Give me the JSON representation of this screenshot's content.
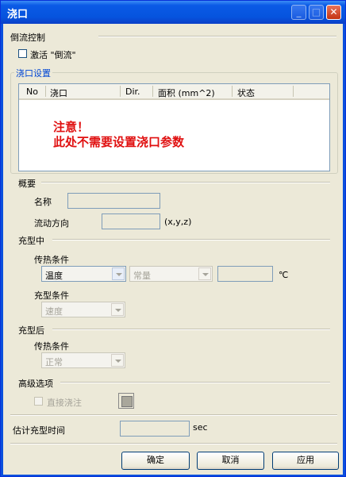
{
  "window": {
    "title": "浇口",
    "min_icon": "minimize-icon",
    "max_icon": "maximize-icon",
    "close_icon": "close-icon"
  },
  "backflow": {
    "header": "倒流控制",
    "checkbox_label": "激活 \"倒流\"",
    "checked": false
  },
  "gate_settings": {
    "header": "浇口设置",
    "columns": [
      "No",
      "浇口",
      "Dir.",
      "面积 (mm^2)",
      "状态"
    ],
    "rows": [],
    "notice_line1": "注意！",
    "notice_line2": "此处不需要设置浇口参数"
  },
  "summary": {
    "header": "概要",
    "name_label": "名称",
    "name_value": "",
    "flow_dir_label": "流动方向",
    "flow_dir_value": "",
    "flow_dir_unit": "(x,y,z)"
  },
  "filling": {
    "header": "充型中",
    "heat_label": "传热条件",
    "heat_type": "温度",
    "heat_mode": "常量",
    "heat_value": "",
    "heat_unit": "℃",
    "fill_cond_label": "充型条件",
    "fill_cond_value": "速度"
  },
  "after_fill": {
    "header": "充型后",
    "heat_label": "传热条件",
    "heat_value": "正常"
  },
  "advanced": {
    "header": "高级选项",
    "direct_pour_label": "直接浇注",
    "direct_pour_checked": false
  },
  "estimate": {
    "label": "估计充型时间",
    "value": "",
    "unit": "sec"
  },
  "buttons": {
    "ok": "确定",
    "cancel": "取消",
    "apply": "应用"
  },
  "colors": {
    "title_bar": "#0a5ae6",
    "section_blue": "#0046d5",
    "notice_red": "#e01010",
    "client_bg": "#ece9d8"
  }
}
